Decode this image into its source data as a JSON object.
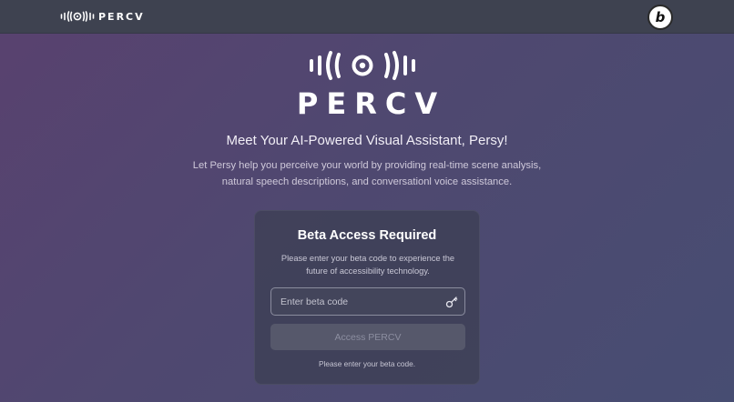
{
  "header": {
    "brand_name": "PERCV",
    "badge_letter": "b"
  },
  "hero": {
    "title": "PERCV",
    "tagline": "Meet Your AI-Powered Visual Assistant, Persy!",
    "description_line1": "Let Persy help you perceive your world by providing real-time scene analysis,",
    "description_line2": "natural speech descriptions, and conversationl voice assistance."
  },
  "access_card": {
    "title": "Beta Access Required",
    "text_line1": "Please enter your beta code to experience the",
    "text_line2": "future of accessibility technology.",
    "input_placeholder": "Enter beta code",
    "input_value": "",
    "button_label": "Access PERCV",
    "hint": "Please enter your beta code."
  },
  "icons": {
    "brand": "sound-wave-logo-icon",
    "badge": "badge-logo-icon",
    "field": "key-icon"
  },
  "colors": {
    "topbar": "#3e4250",
    "background_start": "#59416f",
    "background_end": "#474d72",
    "card": "#3c3e52",
    "button_disabled": "#56586b"
  }
}
